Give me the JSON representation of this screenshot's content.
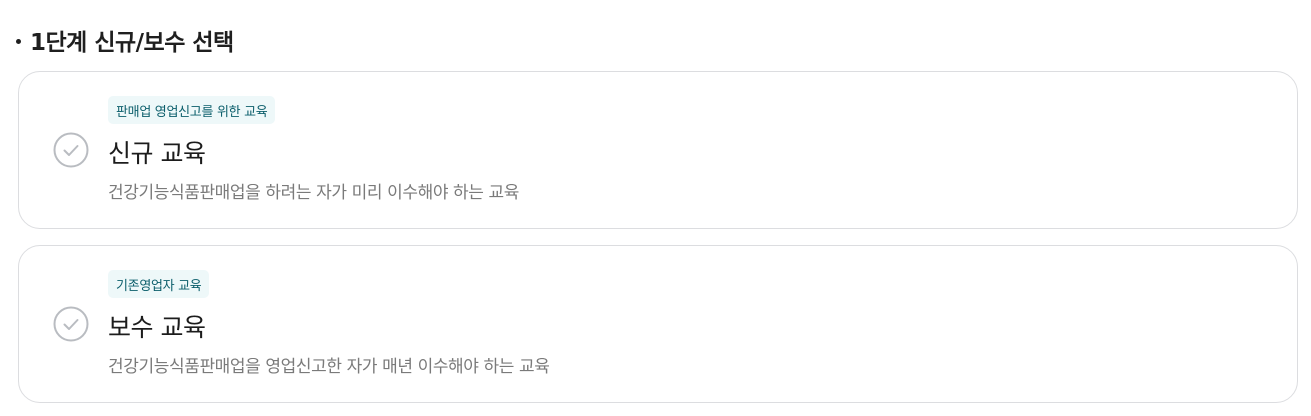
{
  "section": {
    "title": "1단계 신규/보수 선택"
  },
  "options": [
    {
      "badge": "판매업 영업신고를 위한 교육",
      "title": "신규 교육",
      "description": "건강기능식품판매업을 하려는 자가 미리 이수해야 하는 교육",
      "selected": false,
      "icon": "check-circle-icon"
    },
    {
      "badge": "기존영업자 교육",
      "title": "보수 교육",
      "description": "건강기능식품판매업을 영업신고한 자가 매년 이수해야 하는 교육",
      "selected": false,
      "icon": "check-circle-icon"
    }
  ],
  "colors": {
    "badge_bg": "#eef8f9",
    "badge_text": "#0b5e6b",
    "card_border": "#dcdde0",
    "check_icon": "#b9bcc1",
    "description_text": "#7a7a7a"
  }
}
